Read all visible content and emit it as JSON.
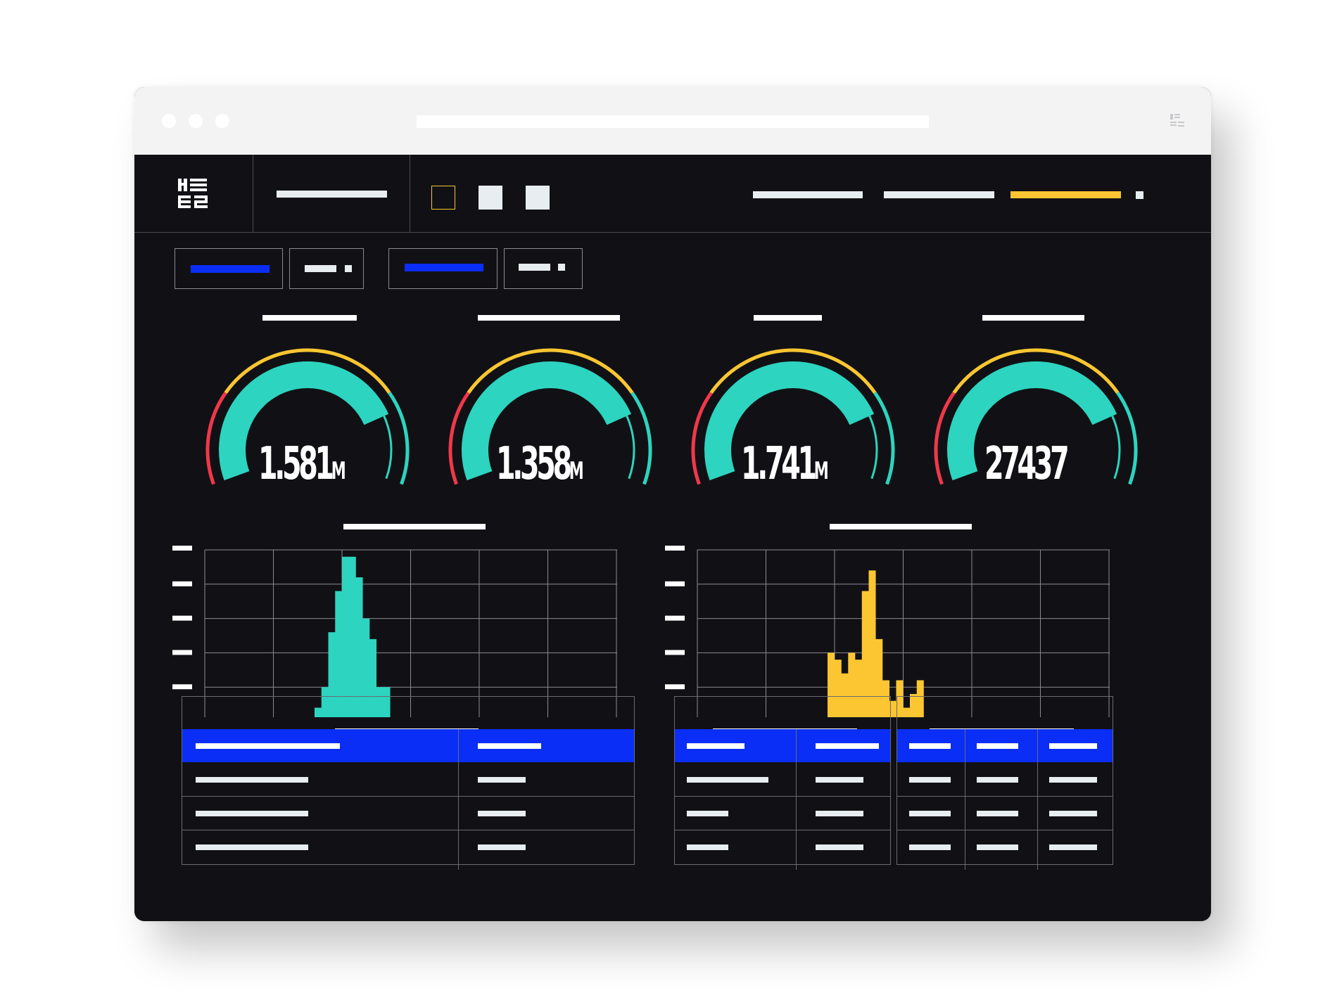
{
  "colors": {
    "accent_blue": "#0a2ef5",
    "accent_yellow": "#fbc631",
    "teal": "#2dd4bf",
    "red": "#f0384a",
    "background": "#111115"
  },
  "header": {
    "logo": "dashboard-logo-icon",
    "view_icons": [
      "square-outline-icon",
      "square-filled-icon",
      "square-filled-icon"
    ]
  },
  "gauges": [
    {
      "value": "1.581",
      "unit": "M",
      "level": 0.8
    },
    {
      "value": "1.358",
      "unit": "M",
      "level": 0.8
    },
    {
      "value": "1.741",
      "unit": "M",
      "level": 0.8
    },
    {
      "value": "27437",
      "unit": "",
      "level": 0.8
    }
  ],
  "chart_data": [
    {
      "type": "bar",
      "color": "#2dd4bf",
      "grid": true,
      "values": [
        2,
        5,
        13,
        19,
        24,
        24,
        21,
        15,
        12,
        5,
        5
      ]
    },
    {
      "type": "bar",
      "color": "#fbc631",
      "grid": true,
      "values": [
        10,
        9,
        7,
        10,
        9,
        19,
        22,
        12,
        6,
        3,
        6,
        2,
        4,
        6
      ]
    }
  ]
}
